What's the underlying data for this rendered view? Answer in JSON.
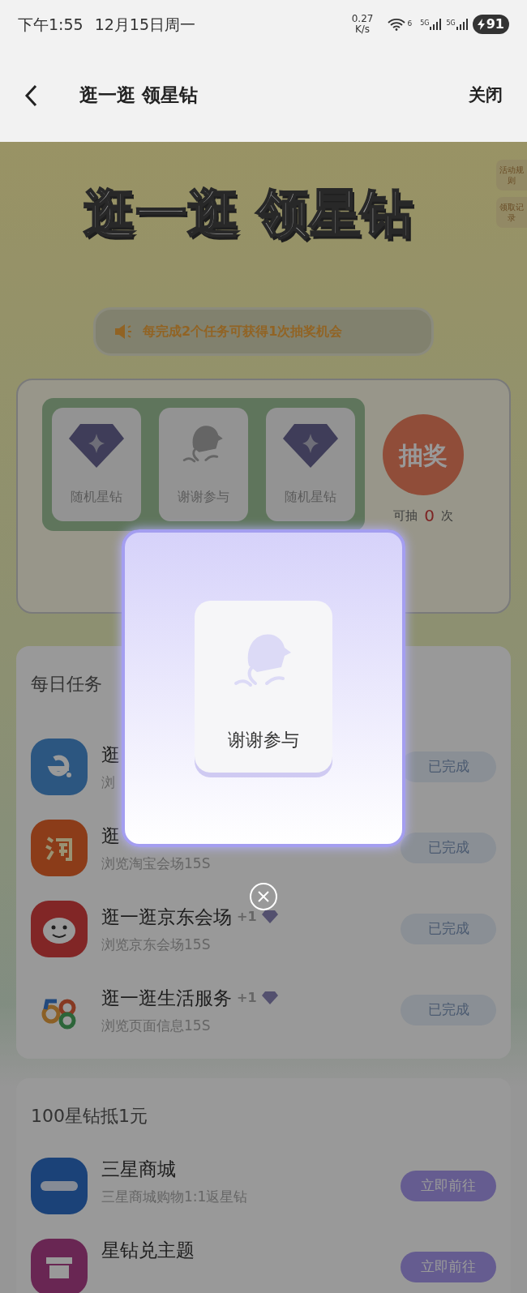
{
  "status_bar": {
    "time": "下午1:55",
    "date": "12月15日周一",
    "net_speed": "0.27",
    "net_unit": "K/s",
    "wifi_badge": "6",
    "signal_labels": [
      "5G",
      "5G"
    ],
    "battery": "91"
  },
  "header": {
    "title": "逛一逛 领星钻",
    "close": "关闭"
  },
  "hero": {
    "title": "逛一逛 领星钻",
    "side_tabs": [
      "活动规则",
      "领取记录"
    ]
  },
  "machine": {
    "notice": "每完成2个任务可获得1次抽奖机会",
    "reels": [
      {
        "kind": "diamond",
        "label": "随机星钻"
      },
      {
        "kind": "thanks",
        "label": "谢谢参与"
      },
      {
        "kind": "diamond",
        "label": "随机星钻"
      }
    ],
    "draw_button": "抽奖",
    "chances_label": "可抽",
    "chances": "0",
    "chances_unit": "次"
  },
  "daily_tasks": {
    "heading": "每日任务",
    "tasks": [
      {
        "title": "逛",
        "desc": "浏",
        "button": "已完成",
        "done": true
      },
      {
        "title": "逛",
        "desc": "浏览淘宝会场15S",
        "button": "已完成",
        "done": true
      },
      {
        "title": "逛一逛京东会场",
        "reward": "+1",
        "desc": "浏览京东会场15S",
        "button": "已完成",
        "done": true
      },
      {
        "title": "逛一逛生活服务",
        "reward": "+1",
        "desc": "浏览页面信息15S",
        "button": "已完成",
        "done": true
      }
    ]
  },
  "redeem": {
    "heading": "100星钻抵1元",
    "items": [
      {
        "title": "三星商城",
        "desc": "三星商城购物1:1返星钻",
        "button": "立即前往"
      },
      {
        "title": "星钻兑主题",
        "button": "立即前往"
      }
    ]
  },
  "dialog": {
    "result_label": "谢谢参与"
  }
}
